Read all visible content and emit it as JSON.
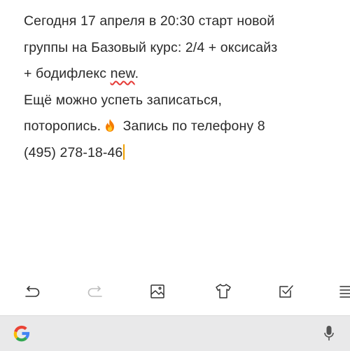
{
  "note": {
    "line1": "Сегодня 17 апреля в 20:30 старт новой",
    "line2": "группы на Базовый курс: 2/4 + оксисайз",
    "line3_pre": "+ бодифлекс ",
    "line3_word": "new",
    "line3_post": ".",
    "line4": "Ещё можно успеть записаться,",
    "line5_pre": "поторопись.",
    "line5_post": " Запись по телефону 8",
    "line6": "(495) 278-18-46"
  },
  "toolbar": {
    "icons": [
      "undo-icon",
      "redo-icon",
      "image-icon",
      "shirt-icon",
      "checkbox-icon",
      "text-format-icon"
    ]
  },
  "searchbar": {
    "icons": [
      "google-icon",
      "microphone-icon"
    ]
  },
  "colors": {
    "text": "#2b2b2b",
    "spellcheck": "#e53935",
    "caret": "#f0a000",
    "search_bg": "#e9e9ea"
  }
}
